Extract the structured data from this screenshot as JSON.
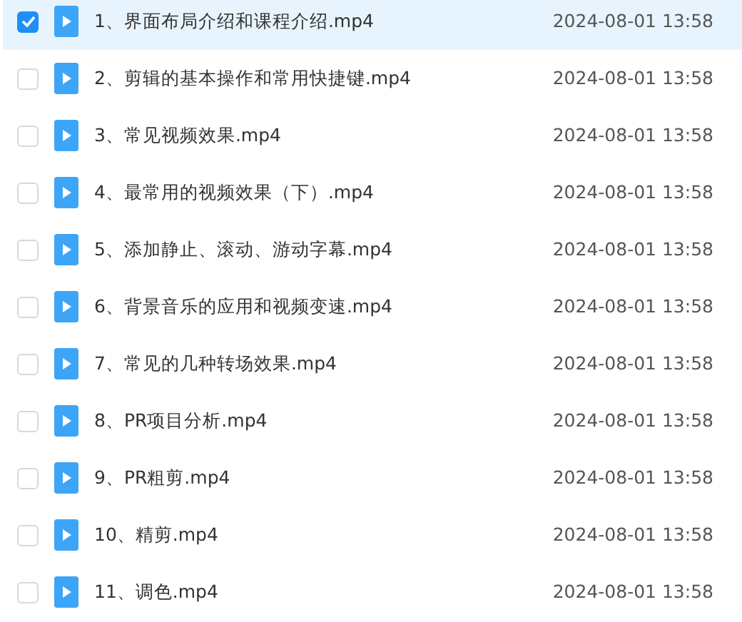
{
  "files": [
    {
      "name": "1、界面布局介绍和课程介绍.mp4",
      "date": "2024-08-01 13:58",
      "selected": true
    },
    {
      "name": "2、剪辑的基本操作和常用快捷键.mp4",
      "date": "2024-08-01 13:58",
      "selected": false
    },
    {
      "name": "3、常见视频效果.mp4",
      "date": "2024-08-01 13:58",
      "selected": false
    },
    {
      "name": "4、最常用的视频效果（下）.mp4",
      "date": "2024-08-01 13:58",
      "selected": false
    },
    {
      "name": "5、添加静止、滚动、游动字幕.mp4",
      "date": "2024-08-01 13:58",
      "selected": false
    },
    {
      "name": "6、背景音乐的应用和视频变速.mp4",
      "date": "2024-08-01 13:58",
      "selected": false
    },
    {
      "name": "7、常见的几种转场效果.mp4",
      "date": "2024-08-01 13:58",
      "selected": false
    },
    {
      "name": "8、PR项目分析.mp4",
      "date": "2024-08-01 13:58",
      "selected": false
    },
    {
      "name": "9、PR粗剪.mp4",
      "date": "2024-08-01 13:58",
      "selected": false
    },
    {
      "name": "10、精剪.mp4",
      "date": "2024-08-01 13:58",
      "selected": false
    },
    {
      "name": "11、调色.mp4",
      "date": "2024-08-01 13:58",
      "selected": false
    }
  ]
}
